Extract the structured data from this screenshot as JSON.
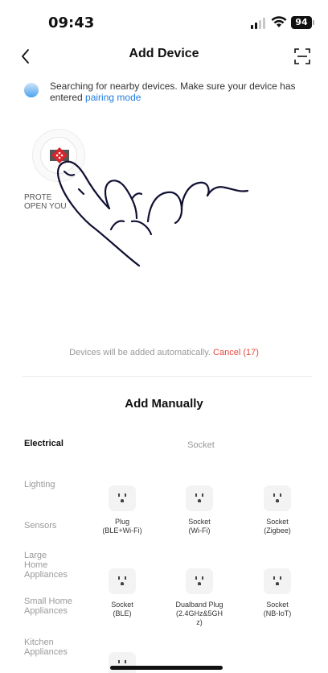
{
  "status": {
    "time": "09:43",
    "battery": "94",
    "icons": [
      "signal-icon",
      "wifi-icon",
      "battery-icon"
    ]
  },
  "nav": {
    "title": "Add Device",
    "back_icon": "back-chevron-icon",
    "scan_icon": "scan-icon"
  },
  "search": {
    "text": "Searching for nearby devices. Make sure your device has entered",
    "link": "pairing mode"
  },
  "discovered": {
    "name": "PROTE\nOPEN YOU",
    "logo_color": "#d8232a"
  },
  "auto_add": {
    "text": "Devices will be added automatically.",
    "cancel": "Cancel (17)"
  },
  "manual": {
    "title": "Add Manually",
    "section": "Socket",
    "categories": [
      {
        "label": "Electrical",
        "active": true
      },
      {
        "label": "Lighting",
        "active": false
      },
      {
        "label": "Sensors",
        "active": false
      },
      {
        "label": "Large\nHome\nAppliances",
        "active": false
      },
      {
        "label": "Small Home\nAppliances",
        "active": false
      },
      {
        "label": "Kitchen\nAppliances",
        "active": false
      }
    ],
    "devices": [
      {
        "label": "Plug\n(BLE+Wi-Fi)"
      },
      {
        "label": "Socket\n(Wi-Fi)"
      },
      {
        "label": "Socket\n(Zigbee)"
      },
      {
        "label": "Socket\n(BLE)"
      },
      {
        "label": "Dualband Plug\n(2.4GHz&5GH\nz)"
      },
      {
        "label": "Socket\n(NB-IoT)"
      }
    ]
  },
  "colors": {
    "accent": "#1e7fe0",
    "cancel": "#e8473f",
    "muted": "#9a9a9a"
  }
}
